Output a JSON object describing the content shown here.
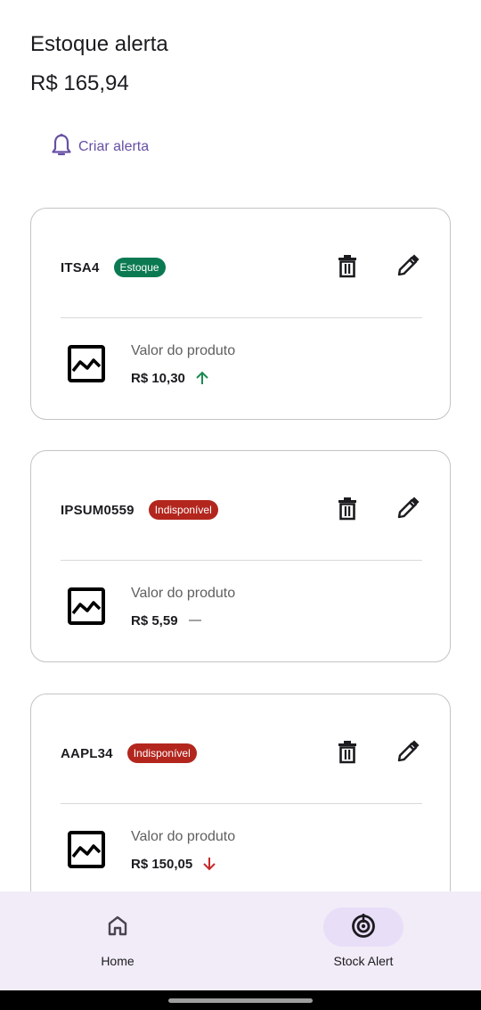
{
  "header": {
    "title": "Estoque alerta",
    "total": "R$ 165,94"
  },
  "create_alert": {
    "label": "Criar alerta",
    "icon": "bell-icon"
  },
  "colors": {
    "accent": "#6750a4",
    "badge_green": "#0b7a52",
    "badge_red": "#b3261e",
    "trend_up": "#1a8a52",
    "trend_down": "#c62828",
    "nav_bg": "#f1ecf7",
    "nav_active": "#e8def8"
  },
  "cards": [
    {
      "ticker": "ITSA4",
      "badge": "Estoque",
      "badge_color": "green",
      "value_label": "Valor do produto",
      "value": "R$ 10,30",
      "trend": "up"
    },
    {
      "ticker": "IPSUM0559",
      "badge": "Indisponível",
      "badge_color": "red",
      "value_label": "Valor do produto",
      "value": "R$ 5,59",
      "trend": "flat"
    },
    {
      "ticker": "AAPL34",
      "badge": "Indisponível",
      "badge_color": "red",
      "value_label": "Valor do produto",
      "value": "R$ 150,05",
      "trend": "down"
    }
  ],
  "nav": {
    "items": [
      {
        "label": "Home",
        "icon": "home-icon",
        "active": false
      },
      {
        "label": "Stock Alert",
        "icon": "target-icon",
        "active": true
      }
    ]
  }
}
